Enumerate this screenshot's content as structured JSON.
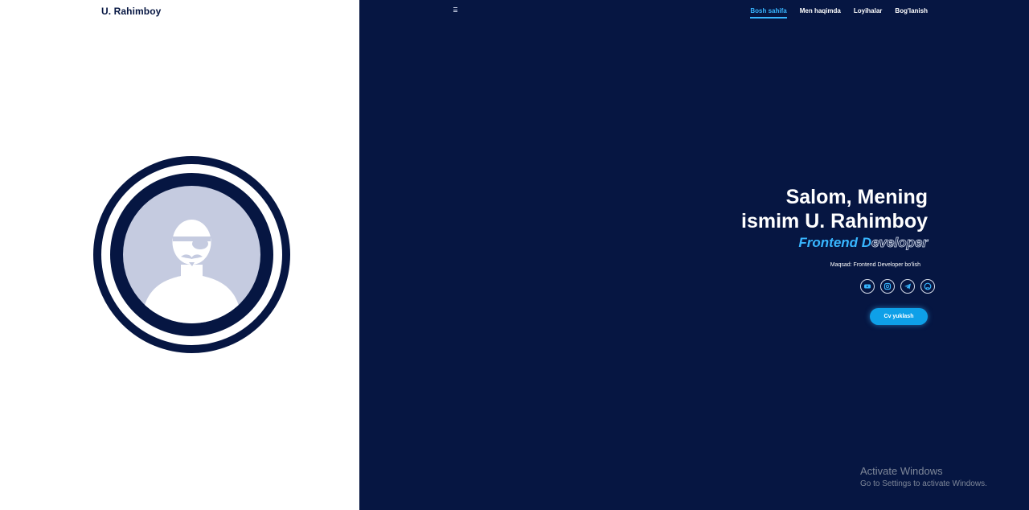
{
  "header": {
    "brand": "U. Rahimboy",
    "nav": [
      {
        "label": "Bosh sahifa",
        "active": true
      },
      {
        "label": "Men haqimda",
        "active": false
      },
      {
        "label": "Loyihalar",
        "active": false
      },
      {
        "label": "Bog'lanish",
        "active": false
      }
    ],
    "menu_icon": "hamburger-icon"
  },
  "hero": {
    "line1": "Salom, Mening",
    "line2": "ismim U. Rahimboy",
    "role_part1": "Frontend D",
    "role_part2": "eveloper",
    "goal": "Maqsad: Frontend Developer bo'lish",
    "socials": [
      {
        "name": "youtube-icon"
      },
      {
        "name": "instagram-icon"
      },
      {
        "name": "telegram-icon"
      },
      {
        "name": "github-icon"
      }
    ],
    "cv_button": "Cv yuklash"
  },
  "windows_notice": {
    "title": "Activate Windows",
    "subtitle": "Go to Settings to activate Windows."
  },
  "colors": {
    "navy": "#061642",
    "accent": "#38b6ff",
    "button": "#0ea0e8",
    "avatar_bg": "#c5cbe0"
  }
}
